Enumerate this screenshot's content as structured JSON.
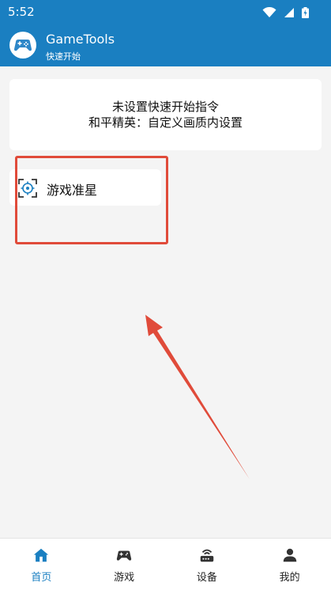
{
  "status_bar": {
    "time": "5:52"
  },
  "app_bar": {
    "title": "GameTools",
    "subtitle": "快速开始"
  },
  "notice": {
    "line1": "未设置快速开始指令",
    "line2": "和平精英：自定义画质内设置"
  },
  "tools": [
    {
      "label": "游戏准星",
      "icon": "crosshair-icon"
    }
  ],
  "bottom_nav": [
    {
      "label": "首页",
      "icon": "home-icon",
      "active": true
    },
    {
      "label": "游戏",
      "icon": "gamepad-icon",
      "active": false
    },
    {
      "label": "设备",
      "icon": "router-icon",
      "active": false
    },
    {
      "label": "我的",
      "icon": "user-icon",
      "active": false
    }
  ],
  "colors": {
    "primary": "#1a7fc1",
    "annotation": "#e04b3a",
    "background": "#f4f4f4"
  }
}
